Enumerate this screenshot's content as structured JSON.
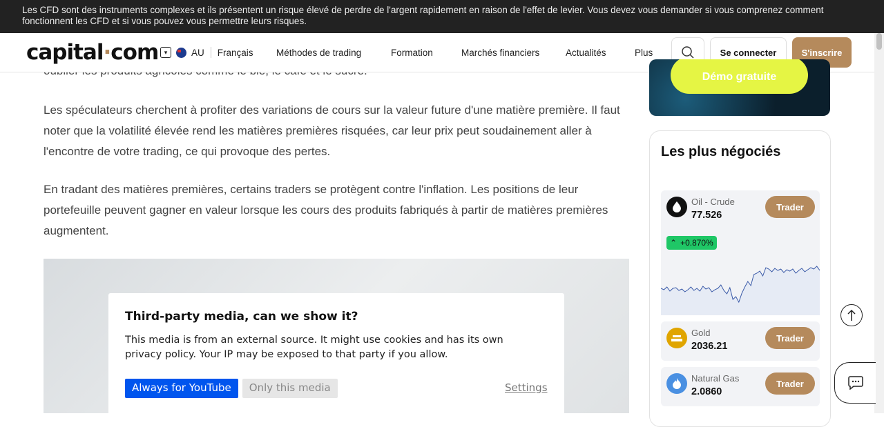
{
  "risk_warning": "Les CFD sont des instruments complexes et ils présentent un risque élevé de perdre de l'argent rapidement en raison de l'effet de levier. Vous devez vous demander si vous comprenez comment fonctionnent les CFD et si vous pouvez vous permettre leurs risques.",
  "header": {
    "logo_main": "capital",
    "logo_dot": "·",
    "logo_tld": "com",
    "region": "AU",
    "language": "Français",
    "nav": [
      "Méthodes de trading",
      "Formation",
      "Marchés financiers",
      "Actualités",
      "Plus"
    ],
    "login_label": "Se connecter",
    "signup_label": "S'inscrire"
  },
  "article": {
    "cut_line": "oublier les produits agricoles comme le blé, le café et le sucre.",
    "paragraphs": [
      "Les spéculateurs cherchent à profiter des variations de cours sur la valeur future d'une matière première. Il faut noter que la volatilité élevée rend les matières premières risquées, car leur prix peut soudainement aller à l'encontre de votre trading, ce qui provoque des pertes.",
      "En tradant des matières premières, certains traders se protègent contre l'inflation. Les positions de leur portefeuille peuvent gagner en valeur lorsque les cours des produits fabriqués à partir de matières premières augmentent."
    ]
  },
  "consent": {
    "title": "Third-party media, can we show it?",
    "description": "This media is from an external source. It might use cookies and has its own privacy policy. Your IP may be exposed to that party if you allow.",
    "always_label": "Always for YouTube",
    "once_label": "Only this media",
    "settings_label": "Settings"
  },
  "sidebar": {
    "demo_label": "Démo gratuite",
    "trending_title": "Les plus négociés",
    "assets": [
      {
        "name": "Oil - Crude",
        "price": "77.526",
        "change": "+0.870%",
        "trade_label": "Trader",
        "icon": "oil-drop-icon",
        "color": "#111111"
      },
      {
        "name": "Gold",
        "price": "2036.21",
        "trade_label": "Trader",
        "icon": "gold-bars-icon",
        "color": "#e0a500"
      },
      {
        "name": "Natural Gas",
        "price": "2.0860",
        "trade_label": "Trader",
        "icon": "flame-icon",
        "color": "#4a90e2"
      }
    ],
    "sparkline": [
      40,
      42,
      38,
      44,
      40,
      39,
      43,
      41,
      45,
      42,
      38,
      43,
      40,
      44,
      37,
      41,
      39,
      45,
      42,
      40,
      35,
      43,
      48,
      39,
      56,
      52,
      60,
      47,
      38,
      30,
      36,
      20,
      18,
      15,
      22,
      10,
      12,
      16,
      11,
      14,
      12,
      17,
      13,
      15,
      12,
      18,
      14,
      11,
      16,
      13,
      10,
      12,
      8,
      14
    ]
  },
  "colors": {
    "accent": "#b58a5c",
    "positive": "#1fc766",
    "consent_primary": "#0055ee"
  }
}
